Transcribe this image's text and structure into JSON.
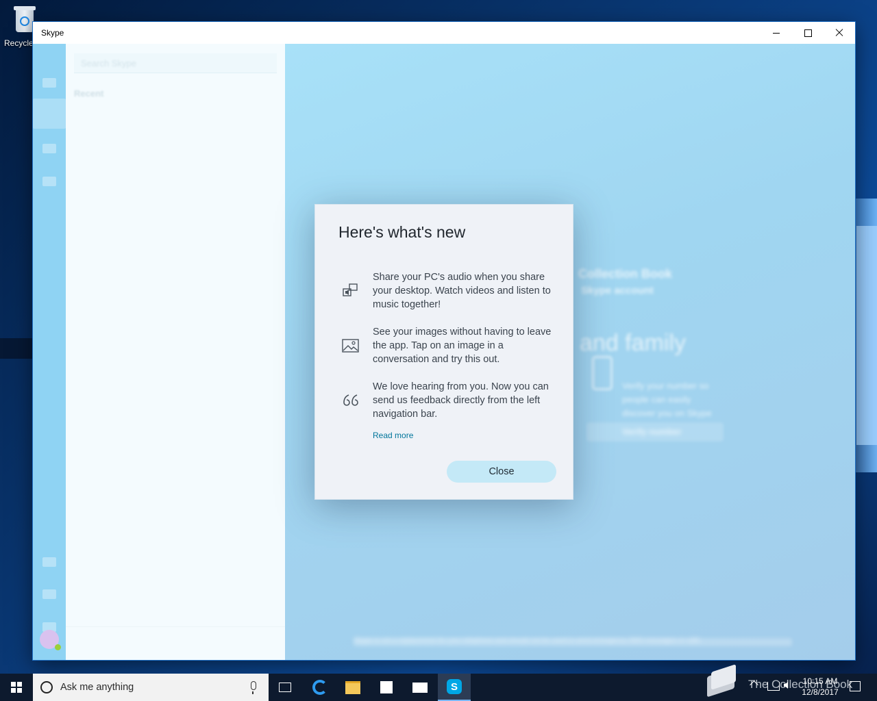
{
  "desktop": {
    "recycle_bin_label": "Recycle Bin"
  },
  "window": {
    "title": "Skype",
    "controls": {
      "minimize": "minimize",
      "maximize": "maximize",
      "close": "close"
    }
  },
  "sidebar": {
    "search_placeholder": "Search Skype",
    "recent_label": "Recent"
  },
  "main_bg": {
    "account_line1": "Collection Book",
    "account_line2": "Skype account",
    "heading": "and family",
    "verify_text_1": "Verify your number so",
    "verify_text_2": "people can easily",
    "verify_text_3": "discover you on Skype",
    "verify_button": "Verify number",
    "footer_note": "Skype is not a replacement for your telephone and should not be used to send emergency SMS messages or calls"
  },
  "dialog": {
    "title": "Here's what's new",
    "features": [
      {
        "icon": "screen-share-audio-icon",
        "text": "Share your PC's audio when you share your desktop. Watch videos and listen to music together!"
      },
      {
        "icon": "image-icon",
        "text": "See your images without having to leave the app. Tap on an image in a conversation and try this out."
      },
      {
        "icon": "quote-feedback-icon",
        "text": "We love hearing from you. Now you can send us feedback directly from the left navigation bar."
      }
    ],
    "read_more": "Read more",
    "close_label": "Close"
  },
  "taskbar": {
    "search_placeholder": "Ask me anything",
    "watermark": "The Collection Book",
    "time": "10:15 AM",
    "date": "12/8/2017"
  },
  "colors": {
    "accent": "#00a7e6",
    "link": "#00759b",
    "close_button_bg": "#c4e9f7",
    "dialog_bg": "#eff2f7"
  }
}
